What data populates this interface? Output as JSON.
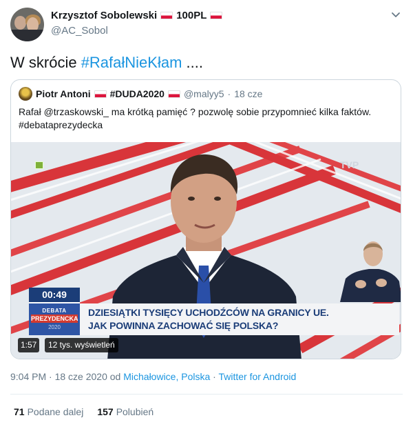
{
  "author": {
    "name": "Krzysztof Sobolewski",
    "name_suffix": "100PL",
    "handle": "@AC_Sobol"
  },
  "tweet": {
    "text_prefix": "W skrócie ",
    "hashtag": "#RafałNieKłam",
    "text_suffix": " ...."
  },
  "quoted": {
    "name": "Piotr Antoni",
    "tag": "#DUDA2020",
    "handle": "@malyy5",
    "separator": "·",
    "date": "18 cze",
    "text_line1": "Rafał @trzaskowski_ ma krótką pamięć ? pozwolę sobie przypomnieć kilka faktów.",
    "text_line2": "#debataprezydecka"
  },
  "video": {
    "clock": "00:49",
    "logo_line1": "DEBATA",
    "logo_line2": "PREZYDENCKA",
    "logo_line3": "2020",
    "caption_line1": "DZIESIĄTKI TYSIĘCY UCHODŹCÓW NA GRANICY UE.",
    "caption_line2": "JAK POWINNA ZACHOWAĆ SIĘ POLSKA?",
    "duration": "1:57",
    "views": "12 tys. wyświetleń"
  },
  "meta": {
    "time": "9:04 PM · 18 cze 2020 od ",
    "location": "Michałowice, Polska",
    "separator": " · ",
    "source": "Twitter for Android"
  },
  "stats": {
    "retweets_count": "71",
    "retweets_label": "Podane dalej",
    "likes_count": "157",
    "likes_label": "Polubień"
  },
  "colors": {
    "link": "#1b95e0",
    "flag_red": "#dc143c",
    "caption_blue": "#1b3d78"
  },
  "icons": [
    "chevron-down-icon",
    "flag-icon"
  ]
}
